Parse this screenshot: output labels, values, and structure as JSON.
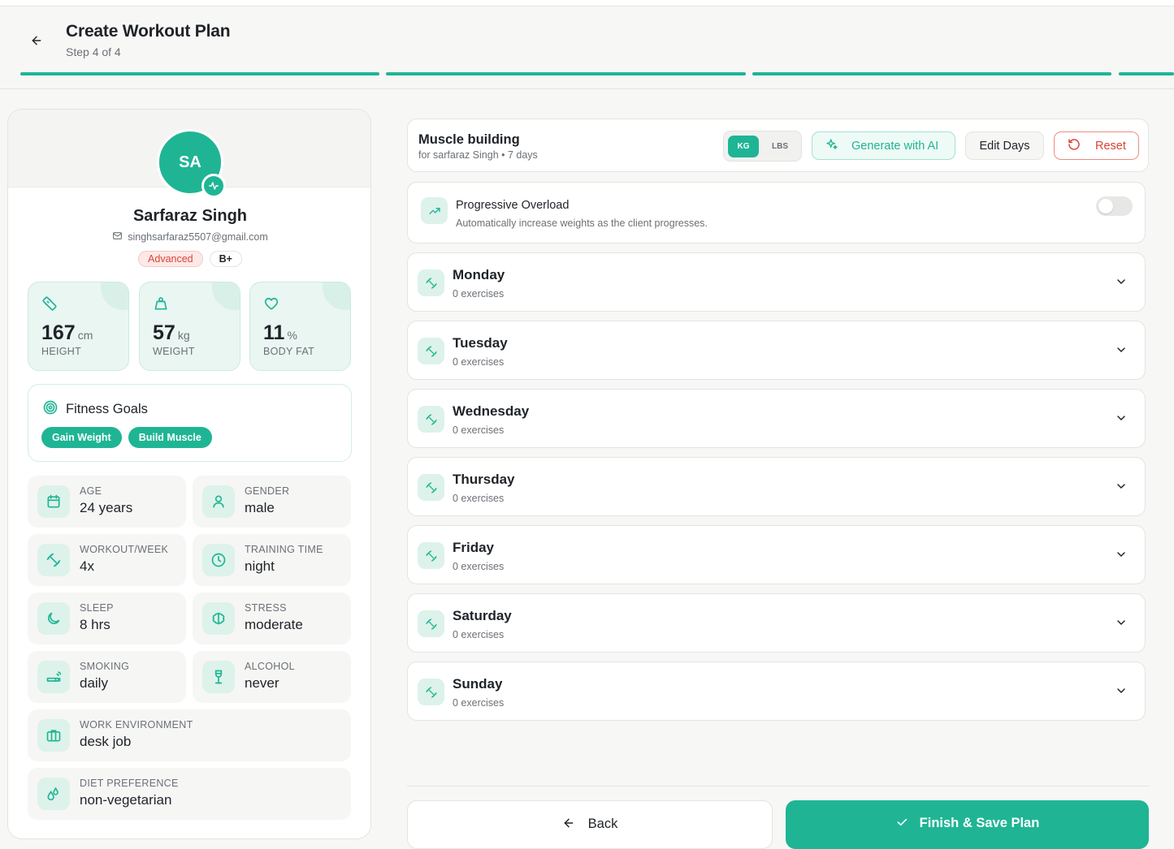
{
  "header": {
    "title": "Create Workout Plan",
    "step": "Step 4 of 4"
  },
  "profile": {
    "initials": "SA",
    "name": "Sarfaraz Singh",
    "email": "singhsarfaraz5507@gmail.com",
    "level": "Advanced",
    "blood_type": "B+",
    "stats": [
      {
        "value": "167",
        "unit": "cm",
        "label": "HEIGHT",
        "icon": "ruler-icon"
      },
      {
        "value": "57",
        "unit": "kg",
        "label": "WEIGHT",
        "icon": "weight-icon"
      },
      {
        "value": "11",
        "unit": "%",
        "label": "BODY FAT",
        "icon": "heart-icon"
      }
    ],
    "goals": {
      "title": "Fitness Goals",
      "items": [
        "Gain Weight",
        "Build Muscle"
      ]
    },
    "info": [
      {
        "label": "AGE",
        "value": "24 years",
        "icon": "calendar-icon"
      },
      {
        "label": "GENDER",
        "value": "male",
        "icon": "user-icon"
      },
      {
        "label": "WORKOUT/WEEK",
        "value": "4x",
        "icon": "dumbbell-icon"
      },
      {
        "label": "TRAINING TIME",
        "value": "night",
        "icon": "clock-icon"
      },
      {
        "label": "SLEEP",
        "value": "8 hrs",
        "icon": "moon-icon"
      },
      {
        "label": "STRESS",
        "value": "moderate",
        "icon": "brain-icon"
      },
      {
        "label": "SMOKING",
        "value": "daily",
        "icon": "cigarette-icon"
      },
      {
        "label": "ALCOHOL",
        "value": "never",
        "icon": "wine-icon"
      },
      {
        "label": "WORK ENVIRONMENT",
        "value": "desk job",
        "icon": "briefcase-icon"
      },
      {
        "label": "DIET PREFERENCE",
        "value": "non-vegetarian",
        "icon": "droplets-icon"
      }
    ]
  },
  "plan": {
    "title": "Muscle building",
    "subtitle": "for sarfaraz Singh • 7 days",
    "unit_kg": "KG",
    "unit_lbs": "LBS",
    "selected_unit": "KG",
    "ai_button": "Generate with AI",
    "edit_button": "Edit Days",
    "reset_button": "Reset"
  },
  "progressive_overload": {
    "title": "Progressive Overload",
    "description": "Automatically increase weights as the client progresses.",
    "enabled": false
  },
  "days": [
    {
      "name": "Monday",
      "count": "0 exercises"
    },
    {
      "name": "Tuesday",
      "count": "0 exercises"
    },
    {
      "name": "Wednesday",
      "count": "0 exercises"
    },
    {
      "name": "Thursday",
      "count": "0 exercises"
    },
    {
      "name": "Friday",
      "count": "0 exercises"
    },
    {
      "name": "Saturday",
      "count": "0 exercises"
    },
    {
      "name": "Sunday",
      "count": "0 exercises"
    }
  ],
  "footer": {
    "back": "Back",
    "finish": "Finish & Save Plan"
  },
  "colors": {
    "accent": "#1fb594",
    "accent_soft": "#ddf2ea",
    "danger": "#d94437"
  }
}
